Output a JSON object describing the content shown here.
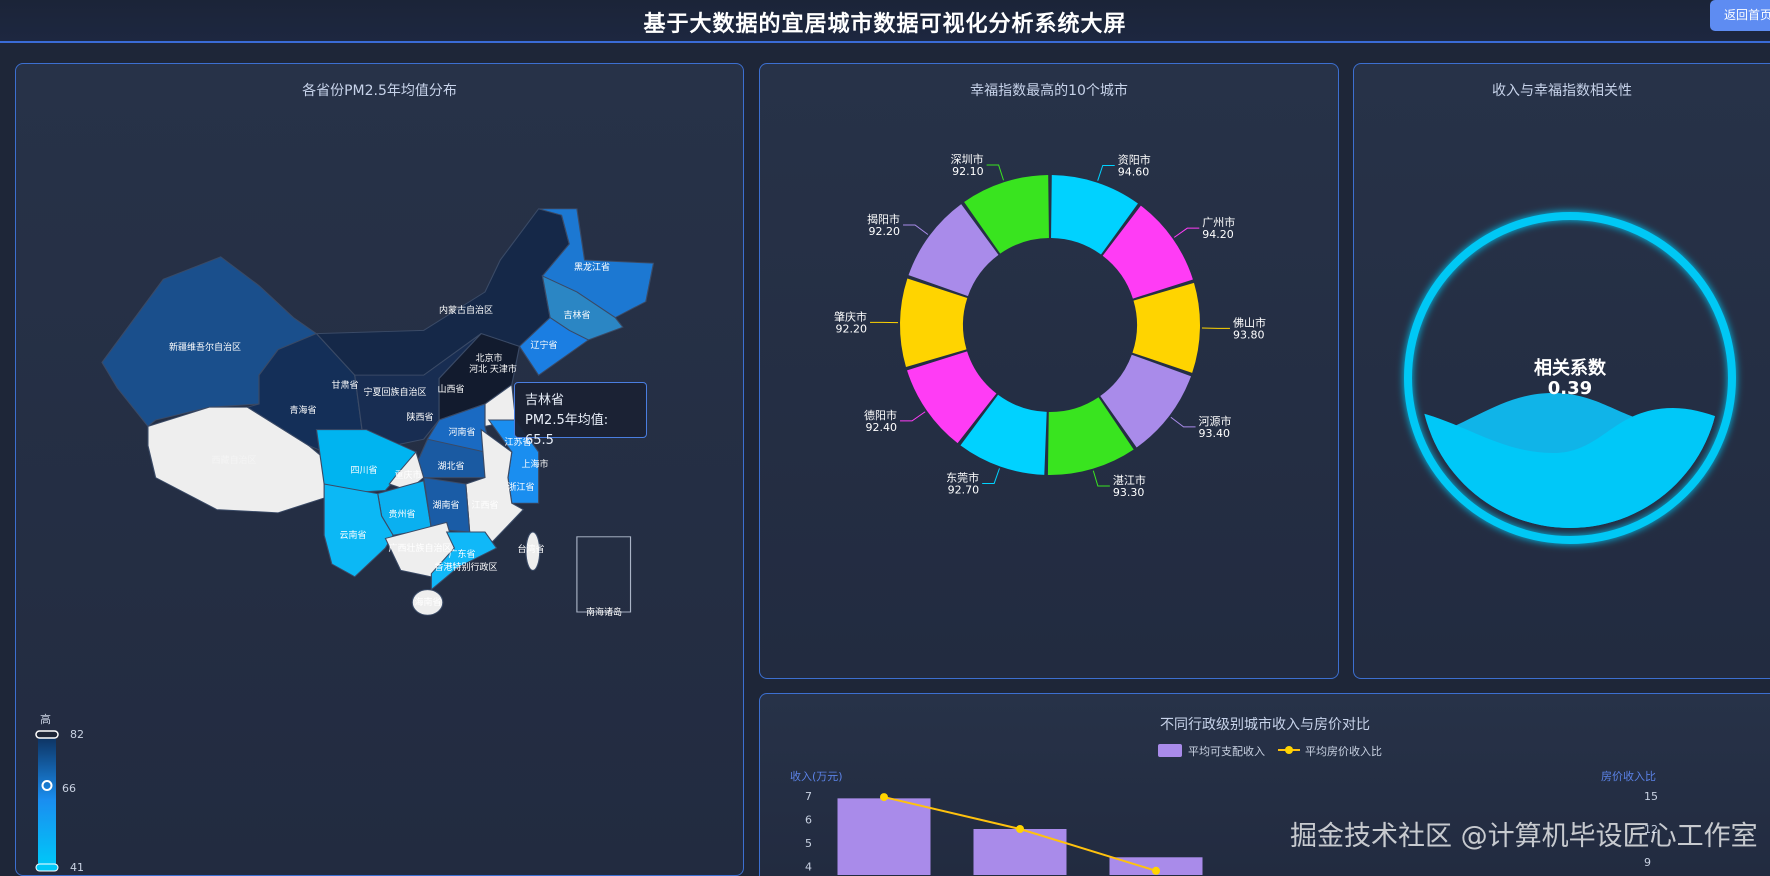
{
  "header": {
    "title": "基于大数据的宜居城市数据可视化分析系统大屏",
    "back_button": "返回首页"
  },
  "map_panel": {
    "title": "各省份PM2.5年均值分布",
    "provinces": [
      "黑龙江省",
      "内蒙古自治区",
      "吉林省",
      "新疆维吾尔自治区",
      "辽宁省",
      "北京市",
      "河北 天津市",
      "甘肃省",
      "宁夏回族自治区",
      "山西省",
      "青海省",
      "陕西省",
      "河南省",
      "江苏省",
      "西藏自治区",
      "四川省",
      "湖北省",
      "上海市",
      "重庆市",
      "浙江省",
      "湖南省",
      "贵州省",
      "江西省",
      "云南省",
      "广西壮族自治区",
      "广东省",
      "台湾省",
      "香港特别行政区",
      "海南省"
    ],
    "south_sea_label": "南海诸岛",
    "tooltip": {
      "name": "吉林省",
      "label": "PM2.5年均值: 65.5"
    },
    "visual_map": {
      "high_label": "高",
      "max": "82",
      "current": "66",
      "min": "41",
      "current_fraction": 0.61
    }
  },
  "donut_panel": {
    "title": "幸福指数最高的10个城市",
    "cities": [
      {
        "name": "资阳市",
        "value": "94.60"
      },
      {
        "name": "广州市",
        "value": "94.20"
      },
      {
        "name": "佛山市",
        "value": "93.80"
      },
      {
        "name": "河源市",
        "value": "93.40"
      },
      {
        "name": "湛江市",
        "value": "93.30"
      },
      {
        "name": "东莞市",
        "value": "92.70"
      },
      {
        "name": "德阳市",
        "value": "92.40"
      },
      {
        "name": "肇庆市",
        "value": "92.20"
      },
      {
        "name": "揭阳市",
        "value": "92.20"
      },
      {
        "name": "深圳市",
        "value": "92.10"
      }
    ],
    "colors": [
      "#00d2ff",
      "#ff3cf5",
      "#ffd400",
      "#a98bea",
      "#39e41f"
    ]
  },
  "correlation_panel": {
    "title": "收入与幸福指数相关性",
    "label": "相关系数",
    "value": "0.39",
    "color": "#00c8f5"
  },
  "chart_data": {
    "type": "bar",
    "title": "不同行政级别城市收入与房价对比",
    "categories": [
      "",
      "",
      ""
    ],
    "series": [
      {
        "name": "平均可支配收入",
        "type": "bar",
        "axis": "left",
        "values": [
          6.9,
          5.6,
          4.4
        ]
      },
      {
        "name": "平均房价收入比",
        "type": "line",
        "axis": "right",
        "values": [
          14.9,
          12.0,
          8.2
        ]
      }
    ],
    "ylabel_left": "收入(万元)",
    "ylabel_right": "房价收入比",
    "left_ticks": [
      "7",
      "6",
      "5",
      "4"
    ],
    "right_ticks": [
      "15",
      "12",
      "9"
    ],
    "ylim_left": [
      0,
      7
    ],
    "ylim_right": [
      0,
      15
    ]
  },
  "watermark": "掘金技术社区 @计算机毕设匠心工作室"
}
